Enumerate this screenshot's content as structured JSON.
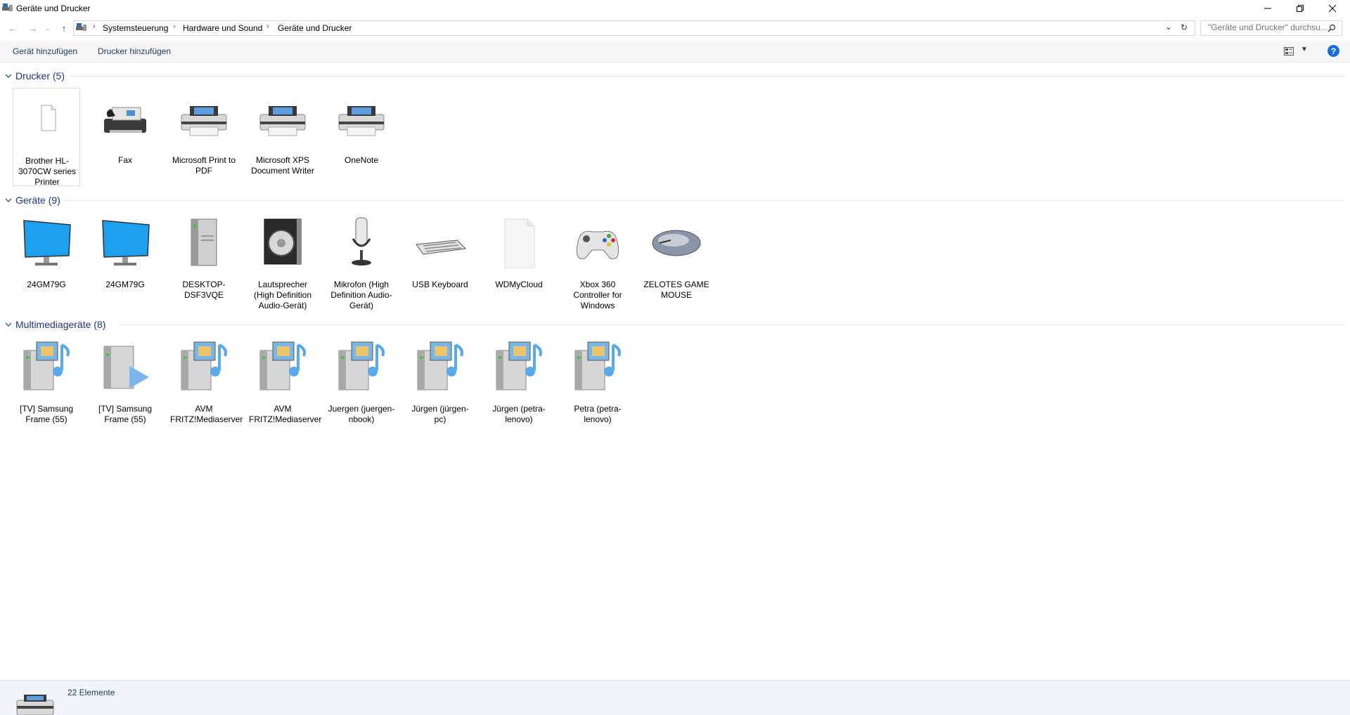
{
  "window": {
    "title": "Geräte und Drucker"
  },
  "breadcrumbs": [
    "Systemsteuerung",
    "Hardware und Sound",
    "Geräte und Drucker"
  ],
  "search": {
    "placeholder": "\"Geräte und Drucker\" durchsu..."
  },
  "toolbar": {
    "add_device": "Gerät hinzufügen",
    "add_printer": "Drucker hinzufügen",
    "help": "?"
  },
  "groups": {
    "printers": {
      "title": "Drucker (5)",
      "items": [
        {
          "label": "Brother HL-3070CW series Printer",
          "icon": "document-icon"
        },
        {
          "label": "Fax",
          "icon": "fax-icon"
        },
        {
          "label": "Microsoft Print to PDF",
          "icon": "printer-icon"
        },
        {
          "label": "Microsoft XPS Document Writer",
          "icon": "printer-icon"
        },
        {
          "label": "OneNote",
          "icon": "printer-icon"
        }
      ]
    },
    "devices": {
      "title": "Geräte (9)",
      "items": [
        {
          "label": "24GM79G",
          "icon": "monitor-icon"
        },
        {
          "label": "24GM79G",
          "icon": "monitor-icon"
        },
        {
          "label": "DESKTOP-DSF3VQE",
          "icon": "computer-tower-icon"
        },
        {
          "label": "Lautsprecher (High Definition Audio-Gerät)",
          "icon": "speaker-icon"
        },
        {
          "label": "Mikrofon (High Definition Audio-Gerät)",
          "icon": "microphone-icon"
        },
        {
          "label": "USB Keyboard",
          "icon": "keyboard-icon"
        },
        {
          "label": "WDMyCloud",
          "icon": "document-icon"
        },
        {
          "label": "Xbox 360 Controller for Windows",
          "icon": "gamepad-icon"
        },
        {
          "label": "ZELOTES GAME MOUSE",
          "icon": "mouse-icon"
        }
      ]
    },
    "media": {
      "title": "Multimediageräte (8)",
      "items": [
        {
          "label": "[TV] Samsung Frame (55)",
          "icon": "media-server-icon"
        },
        {
          "label": "[TV] Samsung Frame (55)",
          "icon": "media-player-icon"
        },
        {
          "label": "AVM FRITZ!Mediaserver",
          "icon": "media-server-icon"
        },
        {
          "label": "AVM FRITZ!Mediaserver",
          "icon": "media-server-icon"
        },
        {
          "label": "Juergen (juergen-nbook)",
          "icon": "media-server-icon"
        },
        {
          "label": "Jürgen (jürgen-pc)",
          "icon": "media-server-icon"
        },
        {
          "label": "Jürgen (petra-lenovo)",
          "icon": "media-server-icon"
        },
        {
          "label": "Petra (petra-lenovo)",
          "icon": "media-server-icon"
        }
      ]
    }
  },
  "status": {
    "count": "22 Elemente"
  },
  "colors": {
    "group_title": "#1e3287",
    "accent": "#1a6ed8",
    "status_bg": "#f1f5fb"
  }
}
